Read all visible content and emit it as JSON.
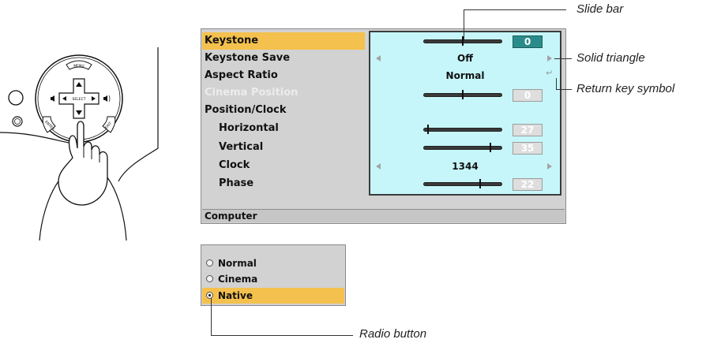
{
  "remote": {
    "menu_label": "MENU",
    "select_label": "SELECT",
    "enter_label": "ENTER",
    "exit_label": "EXIT",
    "auto_adj_label": "AUTO ADJ."
  },
  "menu": {
    "items": [
      {
        "label": "Keystone"
      },
      {
        "label": "Keystone Save"
      },
      {
        "label": "Aspect Ratio"
      },
      {
        "label": "Cinema Position"
      },
      {
        "label": "Position/Clock"
      },
      {
        "label": "Horizontal"
      },
      {
        "label": "Vertical"
      },
      {
        "label": "Clock"
      },
      {
        "label": "Phase"
      }
    ],
    "keystone": {
      "value": "0",
      "level": 0.5
    },
    "keystone_save": {
      "value": "Off"
    },
    "aspect_ratio": {
      "value": "Normal"
    },
    "cinema_position": {
      "value": "0",
      "level": 0.5
    },
    "horizontal": {
      "value": "27",
      "level": 0.06
    },
    "vertical": {
      "value": "35",
      "level": 0.85
    },
    "clock": {
      "value": "1344"
    },
    "phase": {
      "value": "22",
      "level": 0.72
    },
    "footer": "Computer",
    "highlight_color": "#f5c14e",
    "panel_color": "#c6f6fa",
    "active_box_color": "#2a8c8a"
  },
  "radio_menu": {
    "options": [
      {
        "label": "Normal",
        "selected": false
      },
      {
        "label": "Cinema",
        "selected": false
      },
      {
        "label": "Native",
        "selected": true
      }
    ]
  },
  "callouts": {
    "slide_bar": "Slide bar",
    "solid_triangle": "Solid triangle",
    "return_key": "Return key symbol",
    "radio_button": "Radio button"
  }
}
